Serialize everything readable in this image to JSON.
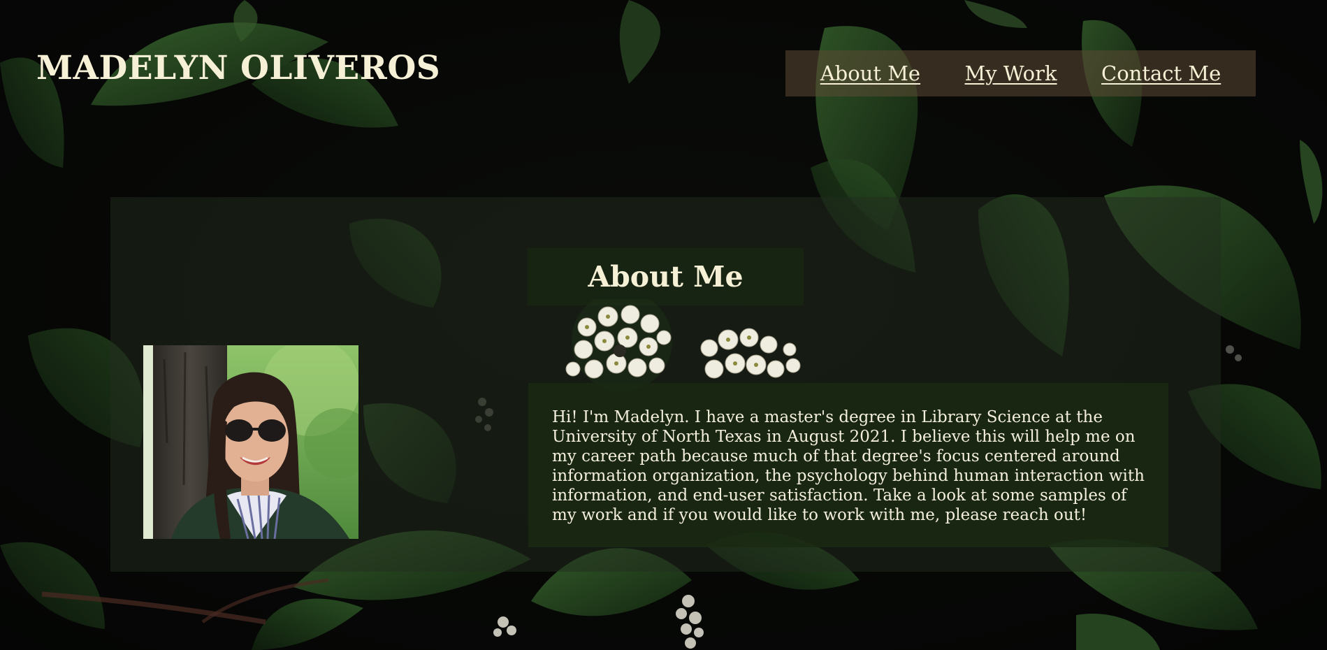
{
  "header": {
    "site_title": "MADELYN OLIVEROS"
  },
  "nav": {
    "items": [
      {
        "label": "About Me"
      },
      {
        "label": "My Work"
      },
      {
        "label": "Contact Me"
      }
    ]
  },
  "about": {
    "heading": "About Me",
    "bio": "Hi! I'm Madelyn. I have a master's degree in Library Science at the University of North Texas in August 2021. I believe this will help me on my career path because much of that degree's focus centered around information organization, the psychology behind human interaction with information, and end-user satisfaction. Take a look at some samples of my work and if you would like to work with me, please reach out!"
  },
  "colors": {
    "text": "#f6f0d6",
    "nav_bg": "#5c4a34",
    "panel_bg": "#222c1e",
    "bio_bg": "#1a2a12",
    "leaf": "#2b4a23"
  }
}
